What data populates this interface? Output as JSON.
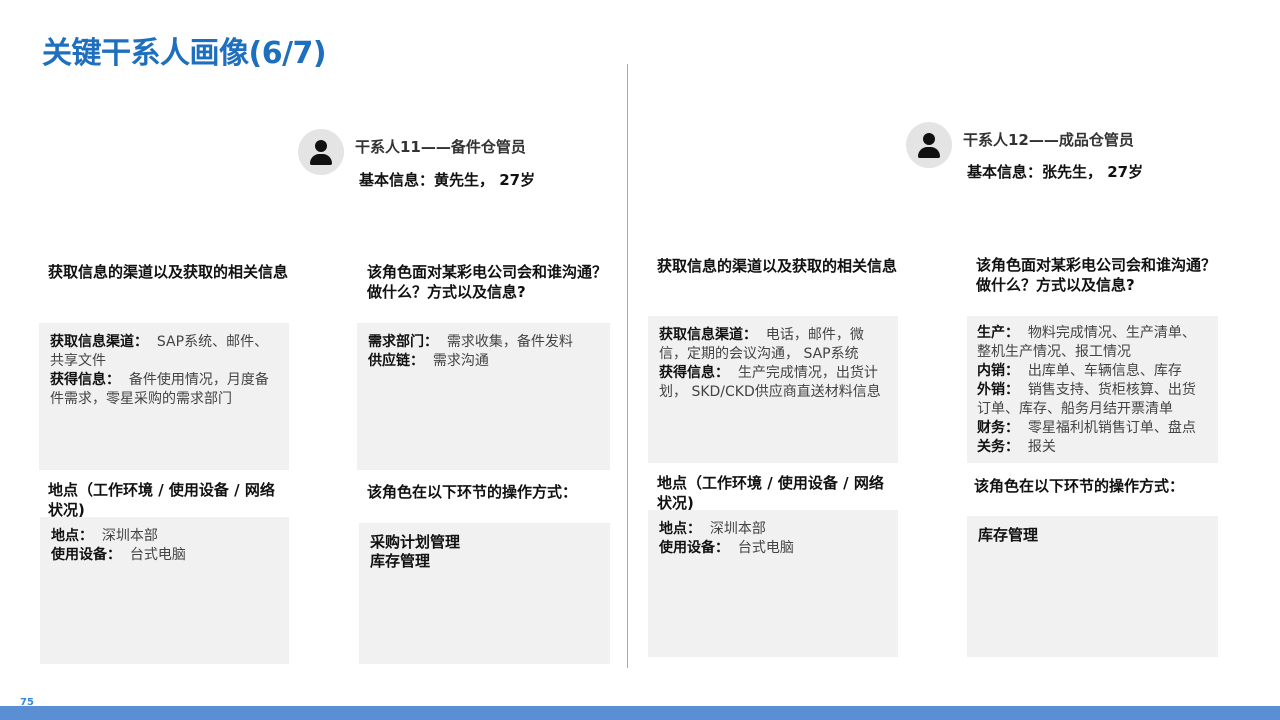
{
  "slide": {
    "title": "关键干系人画像(6/7)",
    "page_number": "75"
  },
  "left": {
    "name": "干系人11——备件仓管员",
    "basic_info": "基本信息：黄先生， 27岁",
    "q1_heading": "获取信息的渠道以及获取的相关信息",
    "q1_box": {
      "channel_label": "获取信息渠道：",
      "channel_value": "SAP系统、邮件、共享文件",
      "obtained_label": "获得信息：",
      "obtained_value": "备件使用情况，月度备件需求，零星采购的需求部门"
    },
    "q2_heading": "该角色面对某彩电公司会和谁沟通？做什么？方式以及信息?",
    "q2_box": {
      "line1_label": "需求部门：",
      "line1_value": "需求收集，备件发料",
      "line2_label": "供应链：",
      "line2_value": "需求沟通"
    },
    "q3_heading": "地点（工作环境 / 使用设备 / 网络状况)",
    "q3_box": {
      "place_label": "地点：",
      "place_value": "深圳本部",
      "device_label": "使用设备：",
      "device_value": "台式电脑"
    },
    "q4_heading": "该角色在以下环节的操作方式：",
    "q4_box": {
      "line1": "采购计划管理",
      "line2": "库存管理"
    }
  },
  "right": {
    "name": "干系人12——成品仓管员",
    "basic_info": "基本信息：张先生，  27岁",
    "q1_heading": "获取信息的渠道以及获取的相关信息",
    "q1_box": {
      "channel_label": "获取信息渠道：",
      "channel_value": "电话，邮件，微信，定期的会议沟通，  SAP系统",
      "obtained_label": "获得信息：",
      "obtained_value": "生产完成情况，出货计划， SKD/CKD供应商直送材料信息"
    },
    "q2_heading": "该角色面对某彩电公司会和谁沟通？做什么？方式以及信息?",
    "q2_box": {
      "line1_label": "生产：",
      "line1_value": "物料完成情况、生产清单、整机生产情况、报工情况",
      "line2_label": "内销：",
      "line2_value": "出库单、车辆信息、库存",
      "line3_label": "外销：",
      "line3_value": "销售支持、货柜核算、出货订单、库存、船务月结开票清单",
      "line4_label": "财务：",
      "line4_value": "零星福利机销售订单、盘点",
      "line5_label": "关务：",
      "line5_value": "报关"
    },
    "q3_heading": "地点（工作环境 / 使用设备 / 网络状况)",
    "q3_box": {
      "place_label": "地点：",
      "place_value": "深圳本部",
      "device_label": "使用设备：",
      "device_value": "台式电脑"
    },
    "q4_heading": "该角色在以下环节的操作方式：",
    "q4_box": {
      "line1": "库存管理"
    }
  },
  "colors": {
    "title": "#1f6fbf",
    "divider": "#c9a94a",
    "box_bg": "#f1f1f1",
    "bottom_bar": "#5b8fd4"
  }
}
